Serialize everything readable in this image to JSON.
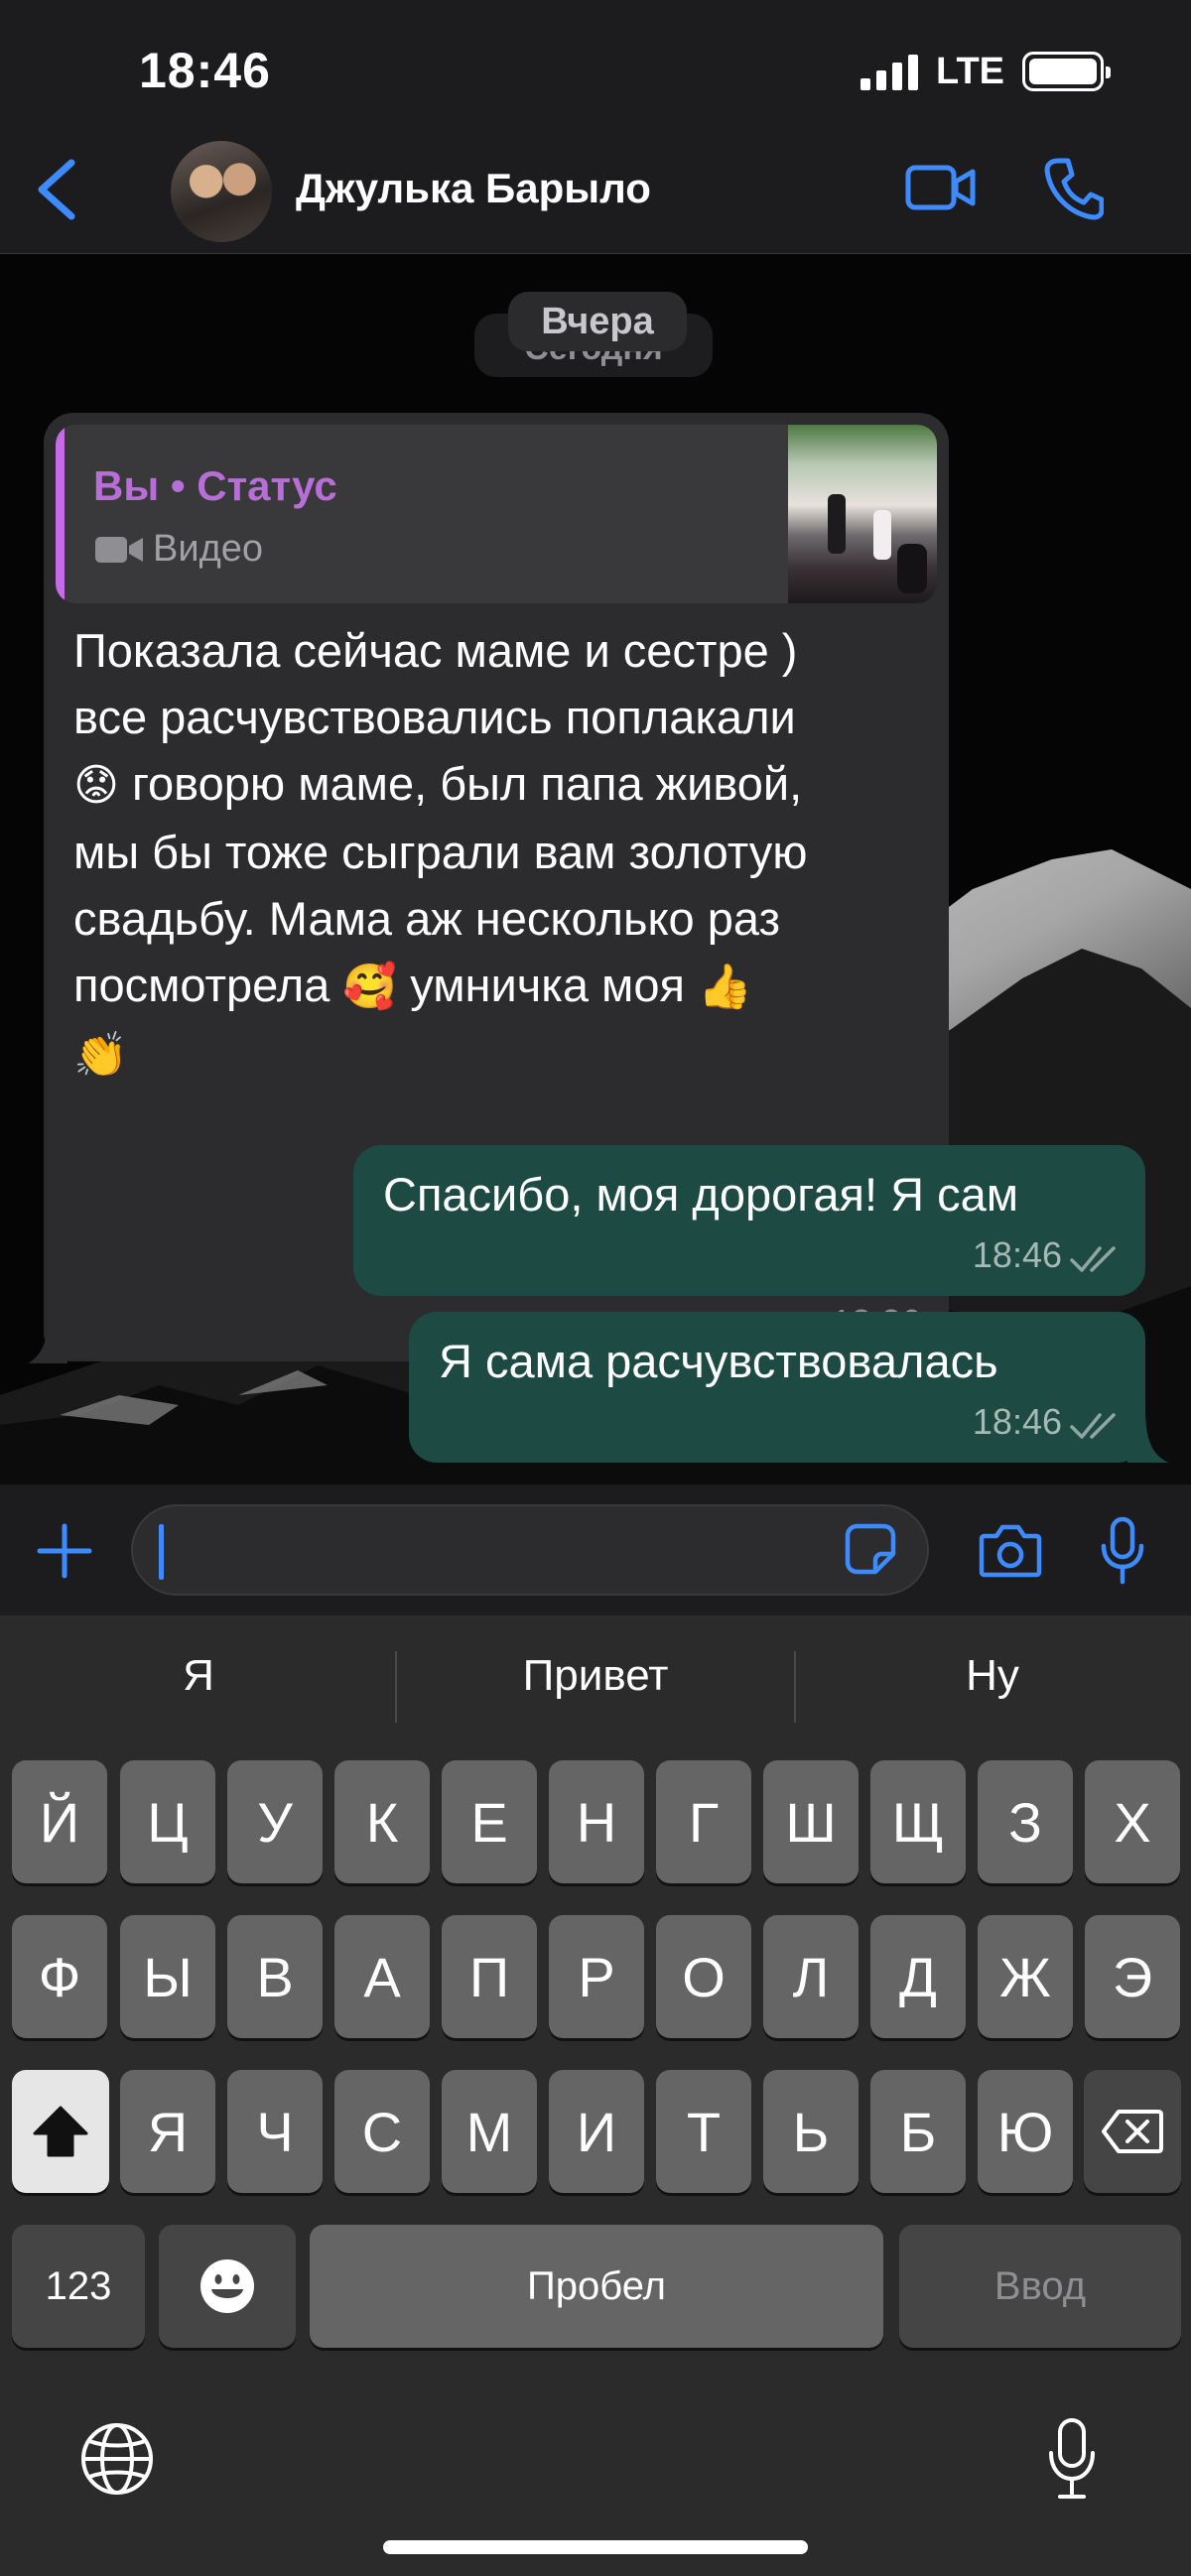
{
  "status_bar": {
    "time": "18:46",
    "network": "LTE"
  },
  "header": {
    "contact_name": "Джулька Барыло"
  },
  "chat": {
    "date_chip_today": "Сегодня",
    "date_chip_yesterday": "Вчера",
    "incoming": {
      "quote_author": "Вы • Статус",
      "quote_media_label": "Видео",
      "text_lines": [
        "Показала сейчас маме и сестре )",
        "все расчувствовались поплакали",
        "говорю маме, был папа живой,",
        "мы бы тоже сыграли вам золотую",
        "свадьбу. Мама аж несколько раз",
        "посмотрела",
        "умничка моя"
      ],
      "time": "18:36"
    },
    "outgoing": [
      {
        "text": "Спасибо, моя дорогая! Я сам",
        "time": "18:46"
      },
      {
        "text": "Я сама расчувствовалась",
        "time": "18:46"
      }
    ]
  },
  "composer": {
    "input_value": ""
  },
  "keyboard": {
    "suggestions": [
      "Я",
      "Привет",
      "Ну"
    ],
    "row1": [
      "Й",
      "Ц",
      "У",
      "К",
      "Е",
      "Н",
      "Г",
      "Ш",
      "Щ",
      "З",
      "Х"
    ],
    "row2": [
      "Ф",
      "Ы",
      "В",
      "А",
      "П",
      "Р",
      "О",
      "Л",
      "Д",
      "Ж",
      "Э"
    ],
    "row3": [
      "Я",
      "Ч",
      "С",
      "М",
      "И",
      "Т",
      "Ь",
      "Б",
      "Ю"
    ],
    "numbers_key": "123",
    "space_key": "Пробел",
    "return_key": "Ввод"
  },
  "colors": {
    "accent": "#3d8bff",
    "outgoing_bubble": "#1d4b43",
    "incoming_bubble": "#2c2c2e",
    "quote_accent": "#c66ae8"
  }
}
